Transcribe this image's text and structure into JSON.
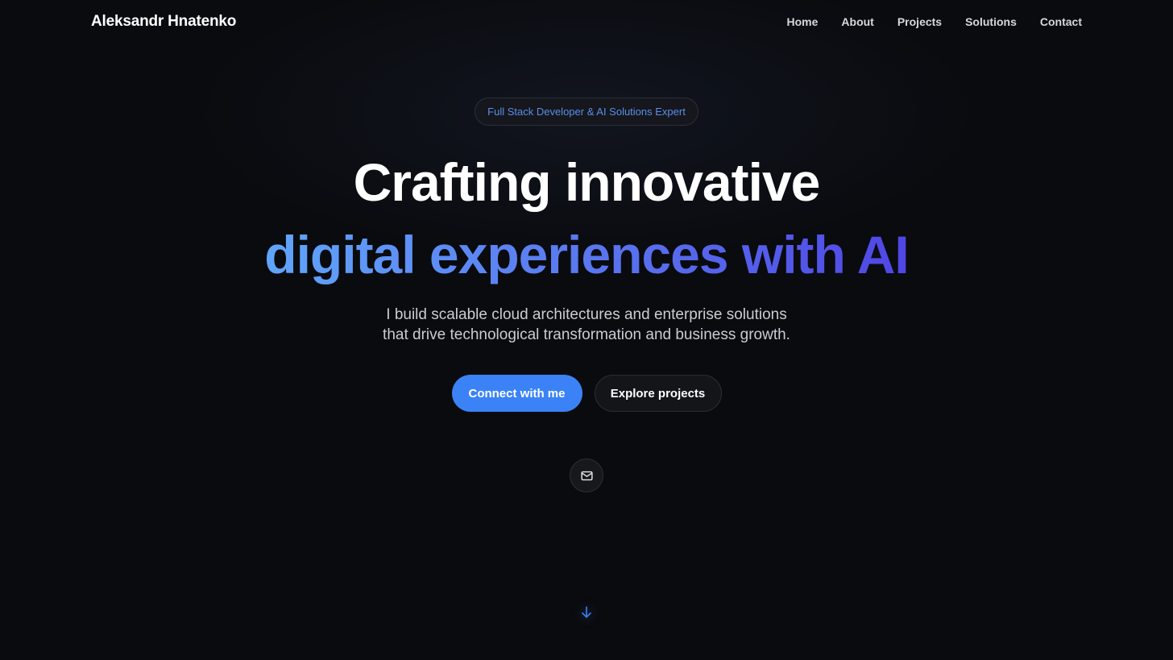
{
  "header": {
    "brand": "Aleksandr Hnatenko",
    "nav": [
      {
        "label": "Home"
      },
      {
        "label": "About"
      },
      {
        "label": "Projects"
      },
      {
        "label": "Solutions"
      },
      {
        "label": "Contact"
      }
    ]
  },
  "hero": {
    "badge": "Full Stack Developer & AI Solutions Expert",
    "headline_line1": "Crafting innovative",
    "headline_line2": "digital experiences with AI",
    "subtitle_line1": "I build scalable cloud architectures and enterprise solutions",
    "subtitle_line2": "that drive technological transformation and business growth.",
    "primary_cta": "Connect with me",
    "secondary_cta": "Explore projects"
  },
  "icons": {
    "contact": "mail-icon",
    "scroll": "arrow-down-icon"
  },
  "colors": {
    "background": "#0a0b0f",
    "accent": "#3b82f6",
    "gradient_start": "#60a5fa",
    "gradient_end": "#4f46e5",
    "badge_text": "#5a8fe8"
  }
}
